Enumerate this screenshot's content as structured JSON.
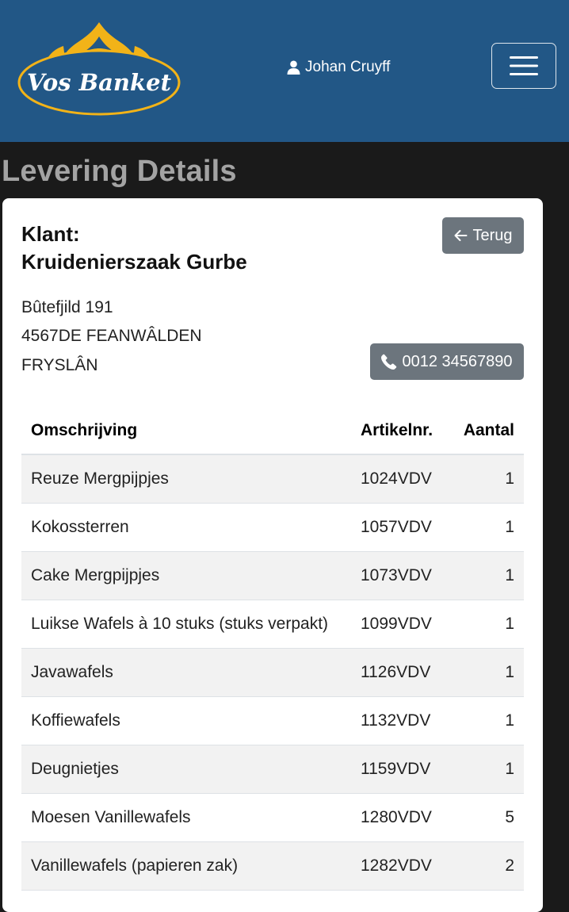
{
  "brand": {
    "name": "Vos Banket",
    "color": "#225786",
    "accent": "#f2b318"
  },
  "header": {
    "user_name": "Johan Cruyff",
    "user_icon": "person-icon",
    "menu_icon": "hamburger-menu-icon"
  },
  "page": {
    "title": "Levering Details"
  },
  "client": {
    "label": "Klant:",
    "name": "Kruidenierszaak Gurbe",
    "address_line1": "Bûtefjild 191",
    "address_line2": "4567DE FEANWÂLDEN",
    "address_line3": "FRYSLÂN",
    "phone": "0012 34567890"
  },
  "buttons": {
    "back_label": "Terug",
    "back_icon": "arrow-left-icon",
    "phone_icon": "phone-icon"
  },
  "table": {
    "headers": {
      "description": "Omschrijving",
      "article": "Artikelnr.",
      "quantity": "Aantal"
    },
    "rows": [
      {
        "description": "Reuze Mergpijpjes",
        "article": "1024VDV",
        "quantity": "1"
      },
      {
        "description": "Kokossterren",
        "article": "1057VDV",
        "quantity": "1"
      },
      {
        "description": "Cake Mergpijpjes",
        "article": "1073VDV",
        "quantity": "1"
      },
      {
        "description": "Luikse Wafels à 10 stuks (stuks verpakt)",
        "article": "1099VDV",
        "quantity": "1"
      },
      {
        "description": "Javawafels",
        "article": "1126VDV",
        "quantity": "1"
      },
      {
        "description": "Koffiewafels",
        "article": "1132VDV",
        "quantity": "1"
      },
      {
        "description": "Deugnietjes",
        "article": "1159VDV",
        "quantity": "1"
      },
      {
        "description": "Moesen Vanillewafels",
        "article": "1280VDV",
        "quantity": "5"
      },
      {
        "description": "Vanillewafels (papieren zak)",
        "article": "1282VDV",
        "quantity": "2"
      }
    ]
  }
}
